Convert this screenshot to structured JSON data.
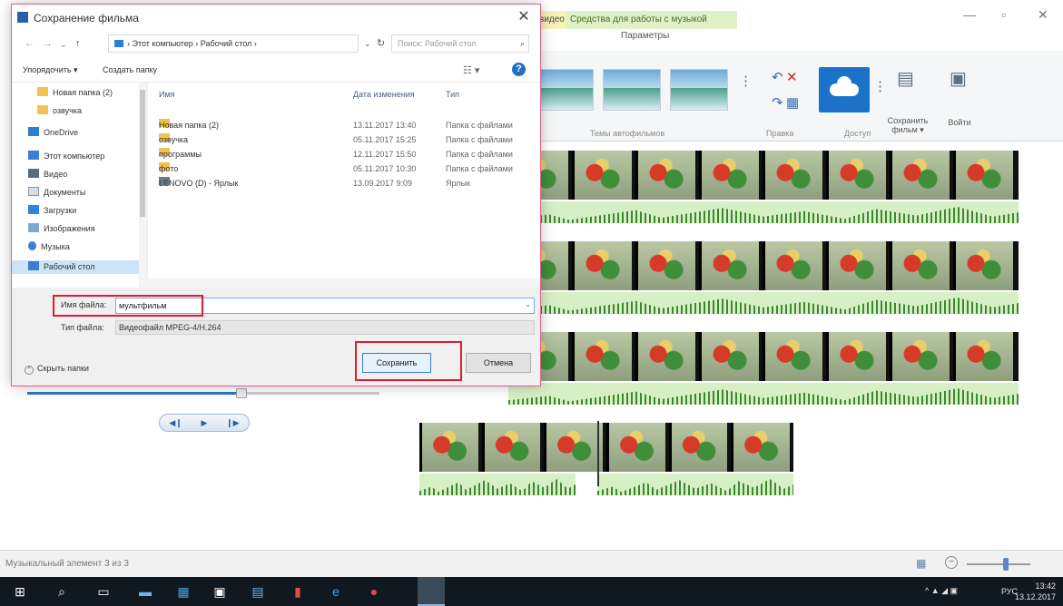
{
  "dialog": {
    "title": "Сохранение фильма",
    "breadcrumb": "› Этот компьютер › Рабочий стол ›",
    "search_placeholder": "Поиск: Рабочий стол",
    "toolbar": {
      "organize": "Упорядочить ▾",
      "new_folder": "Создать папку"
    },
    "nav_items": [
      {
        "label": "Новая папка (2)",
        "icon": "folder-icon"
      },
      {
        "label": "озвучка",
        "icon": "folder-icon"
      },
      {
        "label": "OneDrive",
        "icon": "onedrive-icon"
      },
      {
        "label": "Этот компьютер",
        "icon": "computer-icon"
      },
      {
        "label": "Видео",
        "icon": "video-library-icon"
      },
      {
        "label": "Документы",
        "icon": "documents-icon"
      },
      {
        "label": "Загрузки",
        "icon": "downloads-icon"
      },
      {
        "label": "Изображения",
        "icon": "pictures-icon"
      },
      {
        "label": "Музыка",
        "icon": "music-icon"
      },
      {
        "label": "Рабочий стол",
        "icon": "desktop-icon"
      }
    ],
    "columns": {
      "name": "Имя",
      "date": "Дата изменения",
      "type": "Тип"
    },
    "files": [
      {
        "name": "Новая папка (2)",
        "date": "13.11.2017 13:40",
        "type": "Папка с файлами"
      },
      {
        "name": "озвучка",
        "date": "05.11.2017 15:25",
        "type": "Папка с файлами"
      },
      {
        "name": "программы",
        "date": "12.11.2017 15:50",
        "type": "Папка с файлами"
      },
      {
        "name": "фото",
        "date": "05.11.2017 10:30",
        "type": "Папка с файлами"
      },
      {
        "name": "LENOVO (D) - Ярлык",
        "date": "13.09.2017 9:09",
        "type": "Ярлык"
      }
    ],
    "filename_label": "Имя файла:",
    "filename_value": "мультфильм",
    "filetype_label": "Тип файла:",
    "filetype_value": "Видеофайл MPEG-4/H.264",
    "hide_folders": "Скрыть папки",
    "save_button": "Сохранить",
    "cancel_button": "Отмена"
  },
  "app": {
    "context_tab_video": "видео",
    "context_tab_music": "Средства для работы с музыкой",
    "ribbon_subtitle": "Параметры",
    "ribbon_groups": {
      "themes": "Темы автофильмов",
      "edit": "Правка",
      "share": "Доступ"
    },
    "save_movie": "Сохранить фильм ▾",
    "sign_in": "Войти",
    "status_text": "Музыкальный элемент 3 из 3"
  },
  "taskbar": {
    "lang": "РУС",
    "time": "13:42",
    "date": "13.12.2017"
  },
  "colors": {
    "accent": "#1f6fc5",
    "highlight": "#e01a2f",
    "taskbar": "#101820"
  }
}
